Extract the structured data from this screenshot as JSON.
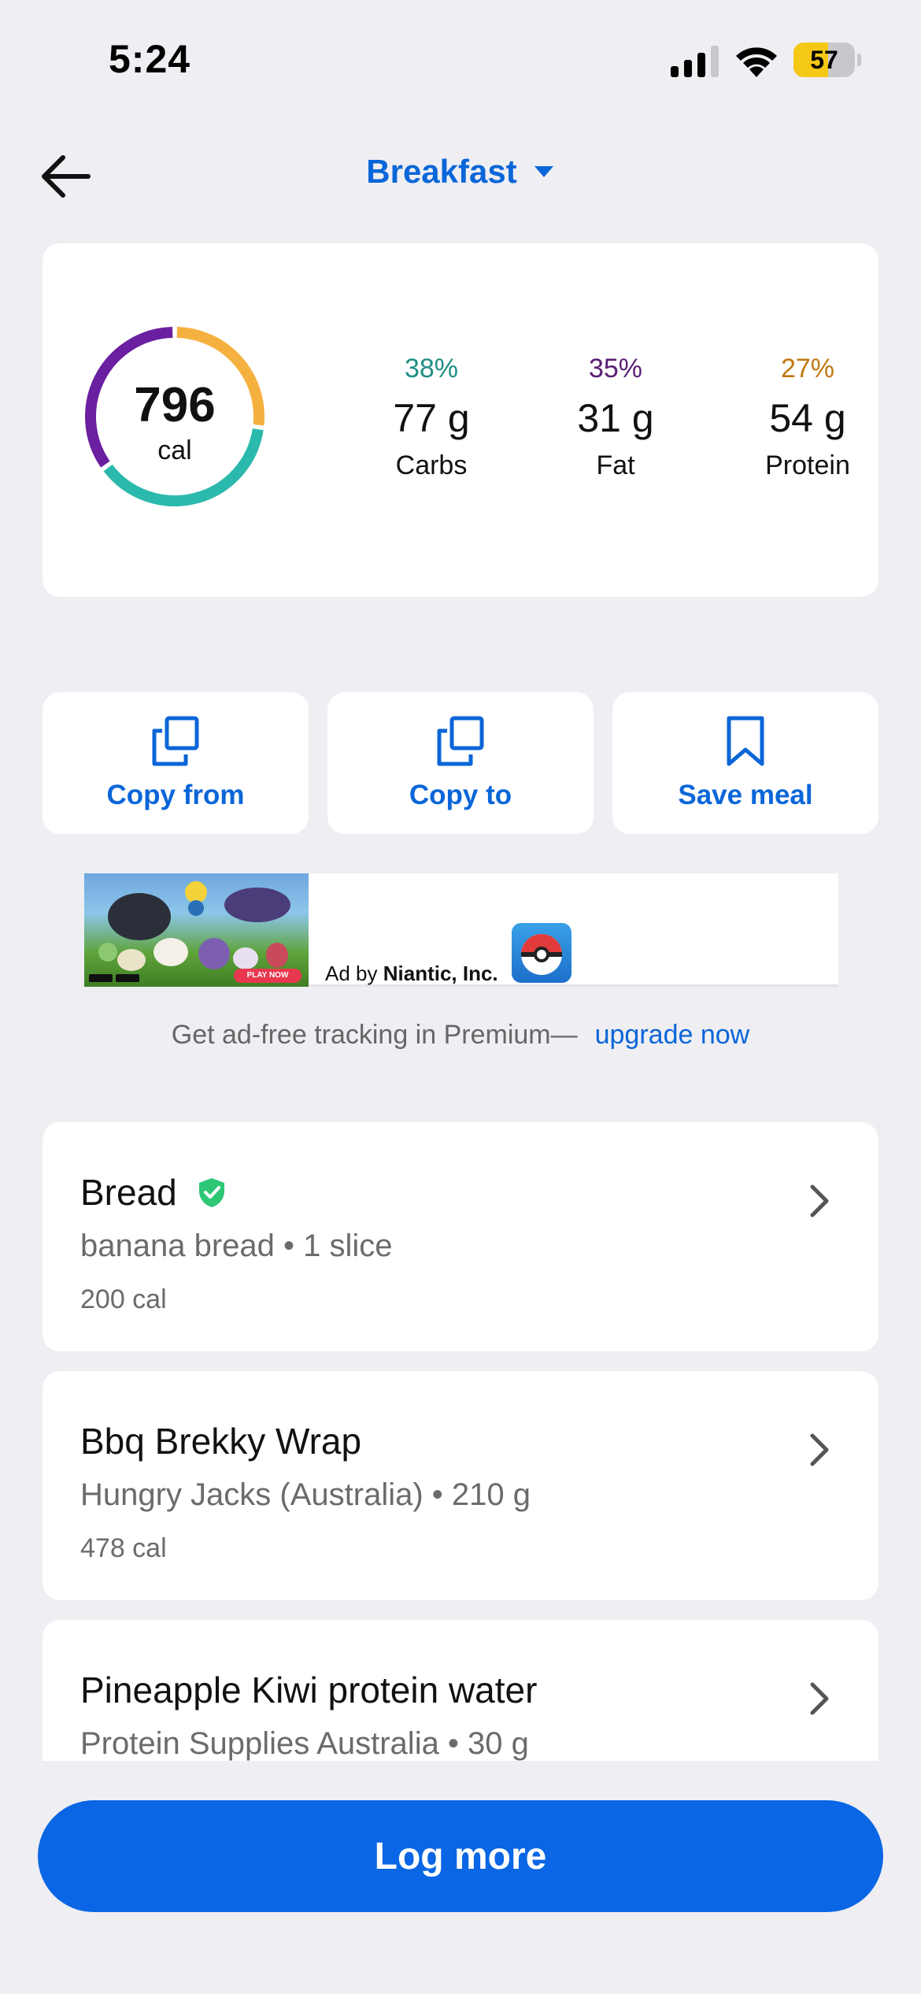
{
  "status_bar": {
    "time": "5:24",
    "battery_level": "57",
    "battery_fraction": 0.57,
    "battery_color": "#F6C816"
  },
  "header": {
    "meal_title": "Breakfast",
    "icons": [
      "back-arrow-icon",
      "caret-down-icon"
    ]
  },
  "summary": {
    "calories_value": "796",
    "calories_unit": "cal",
    "macros": [
      {
        "percent": "38%",
        "grams": "77 g",
        "label": "Carbs",
        "color": "#1F8F83",
        "ring_color": "#2BB9AD"
      },
      {
        "percent": "35%",
        "grams": "31 g",
        "label": "Fat",
        "color": "#5A1F73",
        "ring_color": "#6A1FA0"
      },
      {
        "percent": "27%",
        "grams": "54 g",
        "label": "Protein",
        "color": "#C07810",
        "ring_color": "#F5B13F"
      }
    ]
  },
  "actions": [
    {
      "label": "Copy from",
      "icon": "copy-icon"
    },
    {
      "label": "Copy to",
      "icon": "copy-icon"
    },
    {
      "label": "Save meal",
      "icon": "bookmark-icon"
    }
  ],
  "ad": {
    "prefix": "Ad by",
    "advertiser": "Niantic, Inc.",
    "badge_text": "PLAY NOW"
  },
  "premium": {
    "text": "Get ad-free tracking in Premium—",
    "link": "upgrade now"
  },
  "foods": [
    {
      "name": "Bread",
      "verified": true,
      "detail": "banana bread • 1 slice",
      "calories": "200 cal"
    },
    {
      "name": "Bbq Brekky Wrap",
      "verified": false,
      "detail": "Hungry Jacks (Australia) • 210 g",
      "calories": "478 cal"
    },
    {
      "name": "Pineapple Kiwi protein water",
      "verified": false,
      "detail": "Protein Supplies Australia • 30 g",
      "calories": ""
    }
  ],
  "footer": {
    "log_more_label": "Log more"
  },
  "colors": {
    "accent": "#0A66D8",
    "background": "#EEEEF3",
    "verified": "#2DC775"
  }
}
